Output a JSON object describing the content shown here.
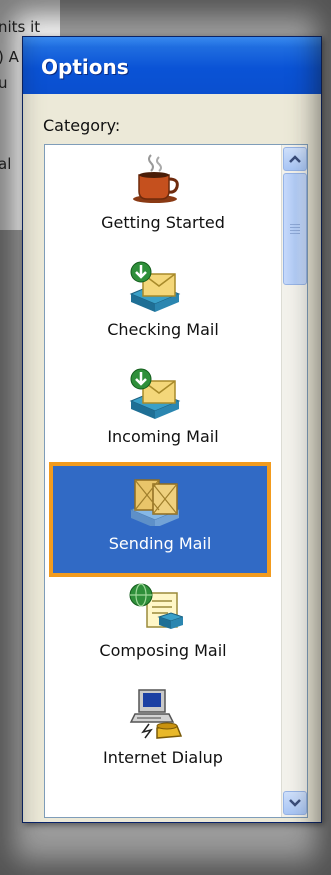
{
  "background_text": [
    "nits it",
    ") A",
    "u",
    "al"
  ],
  "window": {
    "title": "Options"
  },
  "category_label": "Category:",
  "categories": [
    {
      "label": "Getting Started",
      "icon": "coffee-cup-icon",
      "selected": false
    },
    {
      "label": "Checking Mail",
      "icon": "mail-check-icon",
      "selected": false
    },
    {
      "label": "Incoming Mail",
      "icon": "mail-incoming-icon",
      "selected": false
    },
    {
      "label": "Sending Mail",
      "icon": "mail-sending-icon",
      "selected": true
    },
    {
      "label": "Composing Mail",
      "icon": "compose-mail-icon",
      "selected": false
    },
    {
      "label": "Internet Dialup",
      "icon": "computer-phone-icon",
      "selected": false
    }
  ],
  "colors": {
    "titlebar": "#0a53d6",
    "selection": "#316ac5",
    "highlight_outline": "#f29b1e"
  }
}
